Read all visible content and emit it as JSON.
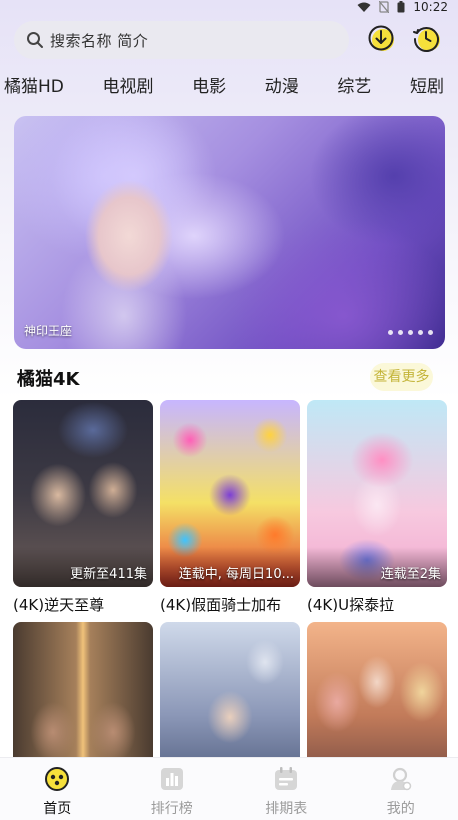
{
  "status_bar": {
    "time": "10:22"
  },
  "search": {
    "placeholder": "搜索名称 简介"
  },
  "header_buttons": {
    "download_icon": "download-icon",
    "history_icon": "history-icon"
  },
  "tabs": [
    "橘猫HD",
    "电视剧",
    "电影",
    "动漫",
    "综艺",
    "短剧"
  ],
  "banner": {
    "caption": "神印王座",
    "dot_count": 5
  },
  "section": {
    "title": "橘猫4K",
    "more_label": "查看更多"
  },
  "cards": [
    {
      "title": "(4K)逆天至尊",
      "badge": "更新至411集"
    },
    {
      "title": "(4K)假面骑士加布",
      "badge": "连载中, 每周日10..."
    },
    {
      "title": "(4K)U探泰拉",
      "badge": "连载至2集"
    },
    {
      "title": "",
      "badge": ""
    },
    {
      "title": "",
      "badge": ""
    },
    {
      "title": "",
      "badge": ""
    }
  ],
  "bottom_nav": [
    {
      "label": "首页",
      "icon": "home-icon",
      "active": true
    },
    {
      "label": "排行榜",
      "icon": "ranking-icon",
      "active": false
    },
    {
      "label": "排期表",
      "icon": "schedule-icon",
      "active": false
    },
    {
      "label": "我的",
      "icon": "profile-icon",
      "active": false
    }
  ],
  "colors": {
    "accent_yellow": "#f6e03b",
    "more_text": "#c4b53a",
    "inactive_nav": "#9b9b9b"
  }
}
